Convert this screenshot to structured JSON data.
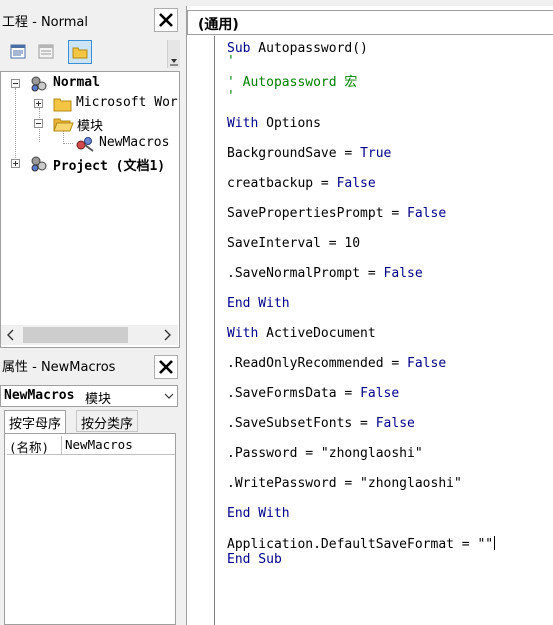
{
  "project_pane": {
    "title": "工程 - Normal",
    "tree": {
      "normal_label": "Normal",
      "microsoft_word_label": "Microsoft Wor",
      "modules_label": "模块",
      "newmacros_label": "NewMacros",
      "project_label": "Project (文档1)"
    }
  },
  "properties_pane": {
    "title": "属性 - NewMacros",
    "object_name": "NewMacros",
    "object_type": "模块",
    "tab_alphabetic": "按字母序",
    "tab_categorized": "按分类序",
    "property_name": "(名称)",
    "property_value": "NewMacros"
  },
  "code_window": {
    "procedure_combo": "(通用)",
    "lines": {
      "l01a": "Sub",
      "l01b": " Autopassword()",
      "l02": "'",
      "l03": "' Autopassword 宏",
      "l04": "'",
      "l05a": "With",
      "l05b": " Options",
      "l06a": "BackgroundSave = ",
      "l06b": "True",
      "l07a": "creatbackup = ",
      "l07b": "False",
      "l08a": "SavePropertiesPrompt = ",
      "l08b": "False",
      "l09": "SaveInterval = 10",
      "l10a": ".SaveNormalPrompt = ",
      "l10b": "False",
      "l11": "End With",
      "l12a": "With",
      "l12b": " ActiveDocument",
      "l13a": ".ReadOnlyRecommended = ",
      "l13b": "False",
      "l14a": ".SaveFormsData = ",
      "l14b": "False",
      "l15a": ".SaveSubsetFonts = ",
      "l15b": "False",
      "l16": ".Password = \"zhonglaoshi\"",
      "l17": ".WritePassword = \"zhonglaoshi\"",
      "l18": "End With",
      "l19": "Application.DefaultSaveFormat = \"\"",
      "l20": "End Sub"
    }
  },
  "colors": {
    "keyword": "#00008b",
    "comment": "#008000",
    "selected_tab_border": "#3c8fd4"
  },
  "icons": [
    "close-icon",
    "view-code-icon",
    "view-object-icon",
    "toggle-folders-icon",
    "vba-project-icon",
    "folder-icon",
    "open-folder-icon",
    "module-icon",
    "chevron-down-icon",
    "arrow-left-icon",
    "arrow-right-icon"
  ]
}
